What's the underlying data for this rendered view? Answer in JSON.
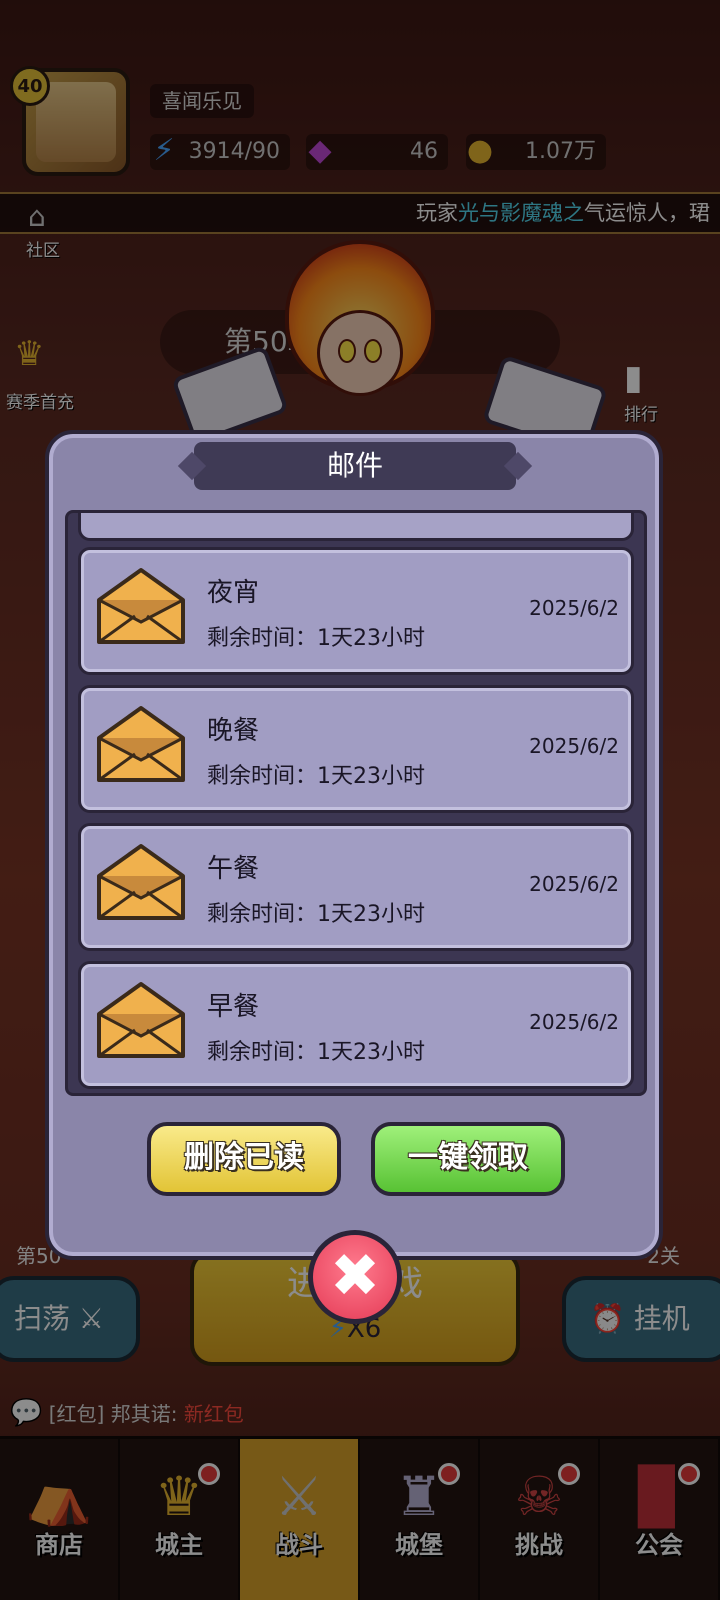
{
  "player": {
    "level": "40",
    "name": "喜闻乐见",
    "energy": "3914/90",
    "gems": "46",
    "coins": "1.07万"
  },
  "ticker": {
    "prefix": "玩家",
    "highlight": "光与影魔魂之",
    "suffix": "气运惊人，珺"
  },
  "side": {
    "community": "社区",
    "season_first": "赛季首充",
    "ranking": "排行"
  },
  "stage": {
    "label": "第50章 … Ⅱ"
  },
  "mail_dialog": {
    "title": "邮件",
    "items": [
      {
        "title": "夜宵",
        "remain": "剩余时间：1天23小时",
        "date": "2025/6/2"
      },
      {
        "title": "晚餐",
        "remain": "剩余时间：1天23小时",
        "date": "2025/6/2"
      },
      {
        "title": "午餐",
        "remain": "剩余时间：1天23小时",
        "date": "2025/6/2"
      },
      {
        "title": "早餐",
        "remain": "剩余时间：1天23小时",
        "date": "2025/6/2"
      }
    ],
    "delete_read": "删除已读",
    "claim_all": "一键领取",
    "close": "✖"
  },
  "battle": {
    "level_left": "第50",
    "level_right": "-2关",
    "sweep": "扫荡",
    "enter": "进入游戏",
    "cost": "X6",
    "idle": "挂机"
  },
  "chat": {
    "tag": "[红包]",
    "user": "邦其诺:",
    "msg": "新红包"
  },
  "nav": [
    {
      "label": "商店",
      "icon": "shop-icon"
    },
    {
      "label": "城主",
      "icon": "crown-icon"
    },
    {
      "label": "战斗",
      "icon": "swords-icon"
    },
    {
      "label": "城堡",
      "icon": "castle-icon"
    },
    {
      "label": "挑战",
      "icon": "demon-icon"
    },
    {
      "label": "公会",
      "icon": "guild-book-icon"
    }
  ],
  "colors": {
    "modal_bg": "#8a85a9",
    "claim_green": "#58c234",
    "delete_yellow": "#e2c436",
    "close_red": "#e43a55",
    "ticker_highlight": "#54d9f0"
  }
}
